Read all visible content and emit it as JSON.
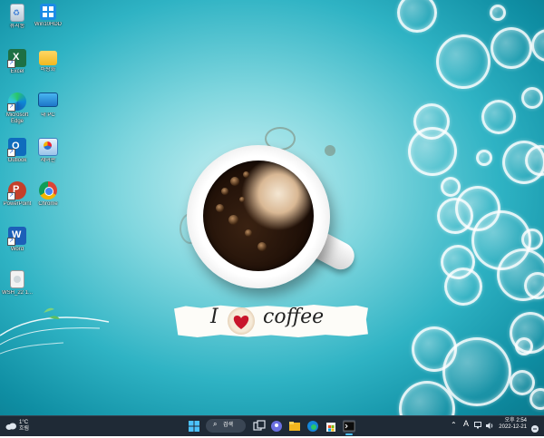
{
  "desktop_icons": [
    {
      "key": "recycle",
      "label": "휴지통"
    },
    {
      "key": "win10hdd",
      "label": "Win10HDD"
    },
    {
      "key": "excel",
      "label": "Excel"
    },
    {
      "key": "folder",
      "label": "바탕화"
    },
    {
      "key": "edge",
      "label": "Microsoft Edge"
    },
    {
      "key": "pc",
      "label": "내 PC"
    },
    {
      "key": "outlook",
      "label": "Outlook"
    },
    {
      "key": "control",
      "label": "제어판"
    },
    {
      "key": "powerpoint",
      "label": "PowerPoint"
    },
    {
      "key": "chrome",
      "label": "Chrome"
    },
    {
      "key": "word",
      "label": "Word"
    },
    {
      "key": "file",
      "label": "WSH_22 1..."
    }
  ],
  "wallpaper": {
    "love_i": "I",
    "love_word": "coffee"
  },
  "taskbar": {
    "weather_temp": "1°C",
    "weather_desc": "흐림",
    "search_label": "검색",
    "ime_label": "A",
    "time": "오후 2:54",
    "date": "2022-12-21"
  },
  "colors": {
    "taskbar_bg": "#1f2a36",
    "accent": "#1a73e8"
  }
}
